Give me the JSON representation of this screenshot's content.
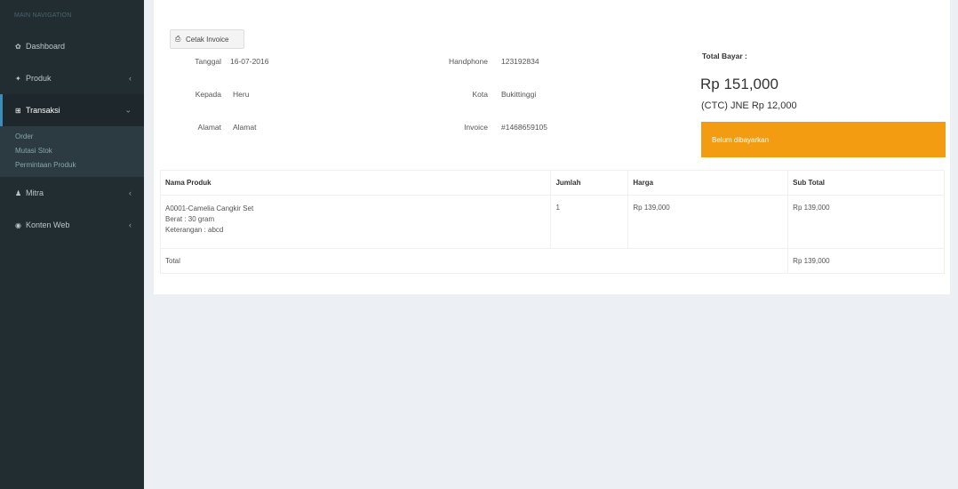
{
  "sidebar": {
    "header": "MAIN NAVIGATION",
    "items": [
      {
        "label": "Dashboard",
        "icon": "dashboard-icon",
        "glyph": "✿"
      },
      {
        "label": "Produk",
        "icon": "product-icon",
        "glyph": "✦",
        "chevron": "‹"
      },
      {
        "label": "Transaksi",
        "icon": "cart-icon",
        "glyph": "⊞",
        "chevron": "⌄"
      },
      {
        "label": "Mitra",
        "icon": "user-icon",
        "glyph": "♟",
        "chevron": "‹"
      },
      {
        "label": "Konten Web",
        "icon": "globe-icon",
        "glyph": "◉",
        "chevron": "‹"
      }
    ],
    "submenu": [
      "Order",
      "Mutasi Stok",
      "Permintaan Produk"
    ]
  },
  "toolbar": {
    "print_label": "Cetak Invoice",
    "print_glyph": "⎙"
  },
  "info": {
    "tanggal_label": "Tanggal",
    "tanggal": "16-07-2016",
    "kepada_label": "Kepada",
    "kepada": "Heru",
    "alamat_label": "Alamat",
    "alamat": "Alamat",
    "handphone_label": "Handphone",
    "handphone": "123192834",
    "kota_label": "Kota",
    "kota": "Bukittinggi",
    "invoice_label": "Invoice",
    "invoice": "#1468659105"
  },
  "summary": {
    "total_label": "Total Bayar :",
    "total_amount": "Rp 151,000",
    "shipping": "(CTC) JNE Rp 12,000",
    "status": "Belum dibayarkan",
    "status_color": "#f39c12"
  },
  "table": {
    "headers": [
      "Nama Produk",
      "Jumlah",
      "Harga",
      "Sub Total"
    ],
    "rows": [
      {
        "name": "A0001-Camelia Cangkir Set",
        "berat": "Berat : 30 gram",
        "keterangan": "Keterangan : abcd",
        "jumlah": "1",
        "harga": "Rp 139,000",
        "subtotal": "Rp 139,000"
      }
    ],
    "total_label": "Total",
    "total_value": "Rp 139,000"
  }
}
